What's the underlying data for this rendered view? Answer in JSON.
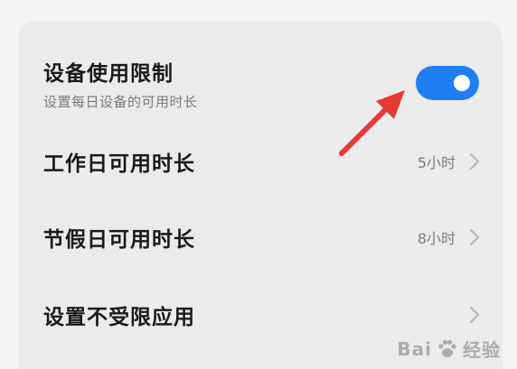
{
  "settings": {
    "device_limit": {
      "title": "设备使用限制",
      "subtitle": "设置每日设备的可用时长",
      "enabled": true
    },
    "workday": {
      "title": "工作日可用时长",
      "value": "5小时"
    },
    "holiday": {
      "title": "节假日可用时长",
      "value": "8小时"
    },
    "unrestricted_apps": {
      "title": "设置不受限应用"
    }
  },
  "watermark": {
    "left": "Bai",
    "right": "经验"
  },
  "colors": {
    "toggle_on": "#1f7ff2",
    "annotation_arrow": "#e53935"
  }
}
